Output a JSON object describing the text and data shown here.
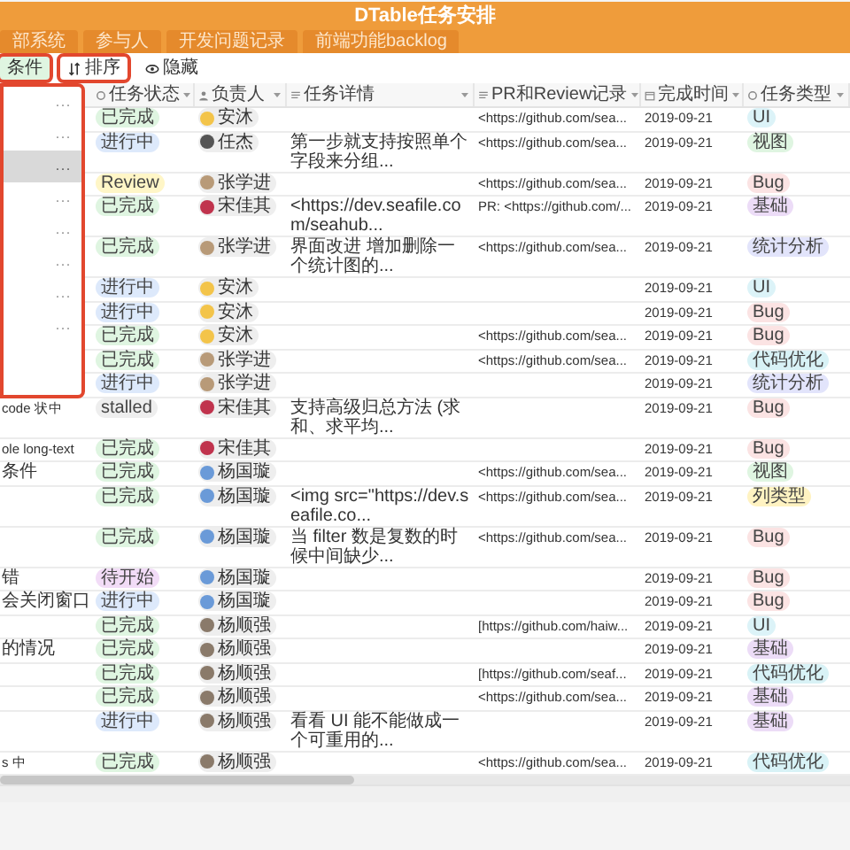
{
  "title": "DTable任务安排",
  "tabs": [
    {
      "label": "部系统"
    },
    {
      "label": "参与人"
    },
    {
      "label": "开发问题记录"
    },
    {
      "label": "前端功能backlog"
    }
  ],
  "toolbar": [
    {
      "kind": "filter",
      "label": "条件"
    },
    {
      "kind": "sort",
      "label": "排序"
    },
    {
      "kind": "hide",
      "label": "隐藏"
    }
  ],
  "columns": [
    {
      "kind": "select",
      "label": "任务状态"
    },
    {
      "kind": "person",
      "label": "负责人"
    },
    {
      "kind": "longtext",
      "label": "任务详情"
    },
    {
      "kind": "longtext",
      "label": "PR和Review记录"
    },
    {
      "kind": "date",
      "label": "完成时间"
    },
    {
      "kind": "select",
      "label": "任务类型"
    }
  ],
  "menu": {
    "items": [
      {
        "more": "···",
        "selected": false
      },
      {
        "more": "···",
        "selected": false
      },
      {
        "more": "···",
        "selected": true
      },
      {
        "more": "···",
        "selected": false
      },
      {
        "more": "···",
        "selected": false
      },
      {
        "more": "···",
        "selected": false
      },
      {
        "more": "···",
        "selected": false
      },
      {
        "more": "···",
        "selected": false
      }
    ]
  },
  "rows": [
    {
      "status": {
        "text": "已完成",
        "color": "#dff5e1"
      },
      "owner": {
        "name": "安沐",
        "color": "#f3c44a"
      },
      "pr": "<https://github.com/sea...",
      "date": "2019-09-21",
      "type": {
        "text": "UI",
        "color": "#dcf3f8"
      }
    },
    {
      "status": {
        "text": "进行中",
        "color": "#dde9fb"
      },
      "owner": {
        "name": "任杰",
        "color": "#555555"
      },
      "detail": "第一步就支持按照单个字段来分组...",
      "pr": "<https://github.com/sea...",
      "date": "2019-09-21",
      "type": {
        "text": "视图",
        "color": "#dff5e1"
      }
    },
    {
      "status": {
        "text": "Review",
        "color": "#fff6c7"
      },
      "owner": {
        "name": "张学进",
        "color": "#b89a78"
      },
      "pr": "<https://github.com/sea...",
      "date": "2019-09-21",
      "type": {
        "text": "Bug",
        "color": "#fbe3e3"
      }
    },
    {
      "status": {
        "text": "已完成",
        "color": "#dff5e1"
      },
      "owner": {
        "name": "宋佳其",
        "color": "#c0334d"
      },
      "detail": "<https://dev.seafile.com/seahub...",
      "pr": "PR: <https://github.com/...",
      "date": "2019-09-21",
      "type": {
        "text": "基础",
        "color": "#ecdcf7"
      }
    },
    {
      "status": {
        "text": "已完成",
        "color": "#dff5e1"
      },
      "owner": {
        "name": "张学进",
        "color": "#b89a78"
      },
      "detail": "界面改进 增加删除一个统计图的...",
      "pr": "<https://github.com/sea...",
      "date": "2019-09-21",
      "type": {
        "text": "统计分析",
        "color": "#e2e4fb"
      }
    },
    {
      "status": {
        "text": "进行中",
        "color": "#dde9fb"
      },
      "owner": {
        "name": "安沐",
        "color": "#f3c44a"
      },
      "date": "2019-09-21",
      "type": {
        "text": "UI",
        "color": "#dcf3f8"
      }
    },
    {
      "status": {
        "text": "进行中",
        "color": "#dde9fb"
      },
      "owner": {
        "name": "安沐",
        "color": "#f3c44a"
      },
      "date": "2019-09-21",
      "type": {
        "text": "Bug",
        "color": "#fbe3e3"
      }
    },
    {
      "status": {
        "text": "已完成",
        "color": "#dff5e1"
      },
      "owner": {
        "name": "安沐",
        "color": "#f3c44a"
      },
      "pr": "<https://github.com/sea...",
      "date": "2019-09-21",
      "type": {
        "text": "Bug",
        "color": "#fbe3e3"
      }
    },
    {
      "status": {
        "text": "已完成",
        "color": "#dff5e1"
      },
      "owner": {
        "name": "张学进",
        "color": "#b89a78"
      },
      "pr": "<https://github.com/sea...",
      "date": "2019-09-21",
      "type": {
        "text": "代码优化",
        "color": "#d8f2f6"
      }
    },
    {
      "status": {
        "text": "进行中",
        "color": "#dde9fb"
      },
      "owner": {
        "name": "张学进",
        "color": "#b89a78"
      },
      "date": "2019-09-21",
      "type": {
        "text": "统计分析",
        "color": "#e2e4fb"
      }
    },
    {
      "name": "code 状中",
      "status": {
        "text": "stalled",
        "color": "#eeeeee"
      },
      "owner": {
        "name": "宋佳其",
        "color": "#c0334d"
      },
      "detail": "支持高级归总方法 (求和、求平均...",
      "date": "2019-09-21",
      "type": {
        "text": "Bug",
        "color": "#fbe3e3"
      }
    },
    {
      "name": "ole long-text",
      "status": {
        "text": "已完成",
        "color": "#dff5e1"
      },
      "owner": {
        "name": "宋佳其",
        "color": "#c0334d"
      },
      "date": "2019-09-21",
      "type": {
        "text": "Bug",
        "color": "#fbe3e3"
      }
    },
    {
      "name": "条件",
      "status": {
        "text": "已完成",
        "color": "#dff5e1"
      },
      "owner": {
        "name": "杨国璇",
        "color": "#6a9ad8"
      },
      "pr": "<https://github.com/sea...",
      "date": "2019-09-21",
      "type": {
        "text": "视图",
        "color": "#dff5e1"
      }
    },
    {
      "status": {
        "text": "已完成",
        "color": "#dff5e1"
      },
      "owner": {
        "name": "杨国璇",
        "color": "#6a9ad8"
      },
      "detail": "<img src=\"https://dev.seafile.co...",
      "pr": "<https://github.com/sea...",
      "date": "2019-09-21",
      "type": {
        "text": "列类型",
        "color": "#fff3c2"
      }
    },
    {
      "status": {
        "text": "已完成",
        "color": "#dff5e1"
      },
      "owner": {
        "name": "杨国璇",
        "color": "#6a9ad8"
      },
      "detail": "当 filter 数是复数的时候中间缺少...",
      "pr": "<https://github.com/sea...",
      "date": "2019-09-21",
      "type": {
        "text": "Bug",
        "color": "#fbe3e3"
      }
    },
    {
      "name": "错",
      "status": {
        "text": "待开始",
        "color": "#f2dcf7"
      },
      "owner": {
        "name": "杨国璇",
        "color": "#6a9ad8"
      },
      "date": "2019-09-21",
      "type": {
        "text": "Bug",
        "color": "#fbe3e3"
      }
    },
    {
      "name": "会关闭窗口",
      "status": {
        "text": "进行中",
        "color": "#dde9fb"
      },
      "owner": {
        "name": "杨国璇",
        "color": "#6a9ad8"
      },
      "date": "2019-09-21",
      "type": {
        "text": "Bug",
        "color": "#fbe3e3"
      }
    },
    {
      "status": {
        "text": "已完成",
        "color": "#dff5e1"
      },
      "owner": {
        "name": "杨顺强",
        "color": "#8a7a6a"
      },
      "pr": "[https://github.com/haiw...",
      "date": "2019-09-21",
      "type": {
        "text": "UI",
        "color": "#dcf3f8"
      }
    },
    {
      "name": "的情况",
      "status": {
        "text": "已完成",
        "color": "#dff5e1"
      },
      "owner": {
        "name": "杨顺强",
        "color": "#8a7a6a"
      },
      "date": "2019-09-21",
      "type": {
        "text": "基础",
        "color": "#ecdcf7"
      }
    },
    {
      "status": {
        "text": "已完成",
        "color": "#dff5e1"
      },
      "owner": {
        "name": "杨顺强",
        "color": "#8a7a6a"
      },
      "pr": "[https://github.com/seaf...",
      "date": "2019-09-21",
      "type": {
        "text": "代码优化",
        "color": "#d8f2f6"
      }
    },
    {
      "status": {
        "text": "已完成",
        "color": "#dff5e1"
      },
      "owner": {
        "name": "杨顺强",
        "color": "#8a7a6a"
      },
      "pr": "<https://github.com/sea...",
      "date": "2019-09-21",
      "type": {
        "text": "基础",
        "color": "#ecdcf7"
      }
    },
    {
      "status": {
        "text": "进行中",
        "color": "#dde9fb"
      },
      "owner": {
        "name": "杨顺强",
        "color": "#8a7a6a"
      },
      "detail": "看看 UI 能不能做成一个可重用的...",
      "date": "2019-09-21",
      "type": {
        "text": "基础",
        "color": "#ecdcf7"
      }
    },
    {
      "name": "s 中",
      "status": {
        "text": "已完成",
        "color": "#dff5e1"
      },
      "owner": {
        "name": "杨顺强",
        "color": "#8a7a6a"
      },
      "pr": "<https://github.com/sea...",
      "date": "2019-09-21",
      "type": {
        "text": "代码优化",
        "color": "#d8f2f6"
      }
    }
  ]
}
